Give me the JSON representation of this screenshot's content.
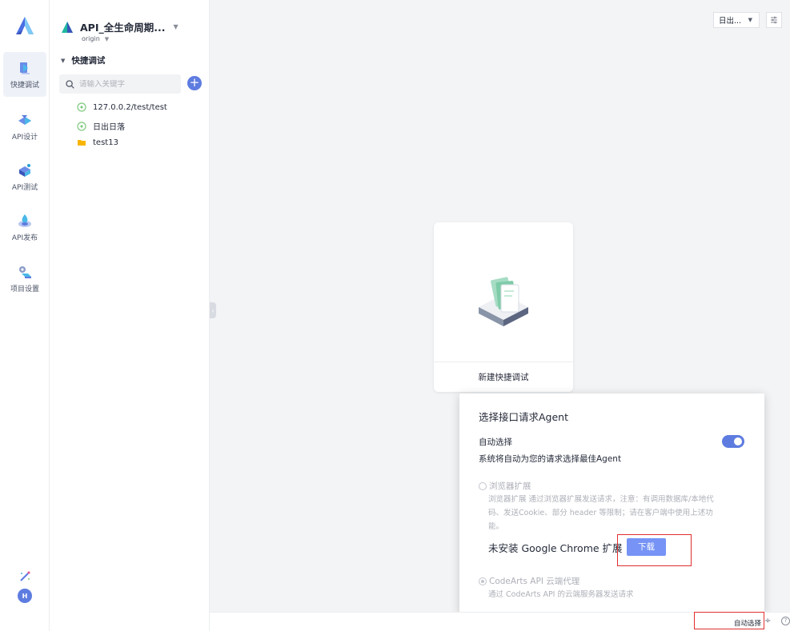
{
  "rail": {
    "items": [
      {
        "label": "快捷调试",
        "active": true
      },
      {
        "label": "API设计",
        "active": false
      },
      {
        "label": "API测试",
        "active": false
      },
      {
        "label": "API发布",
        "active": false
      },
      {
        "label": "项目设置",
        "active": false
      }
    ],
    "avatar_initial": "H"
  },
  "project": {
    "name": "API_全生命周期...",
    "branch": "origin"
  },
  "tree": {
    "section_title": "快捷调试",
    "search_placeholder": "请输入关键字",
    "add_label": "+",
    "items": [
      {
        "label": "127.0.0.2/test/test",
        "type": "request"
      },
      {
        "label": "日出日落",
        "type": "request"
      },
      {
        "label": "test13",
        "type": "folder"
      }
    ]
  },
  "main": {
    "env_select": "日出...",
    "new_card_label": "新建快捷调试"
  },
  "agent_popover": {
    "title": "选择接口请求Agent",
    "auto_label": "自动选择",
    "auto_desc": "系统将自动为您的请求选择最佳Agent",
    "auto_enabled": true,
    "browser_option": "浏览器扩展",
    "browser_desc": "浏览器扩展 通过浏览器扩展发送请求，注意：有调用数据库/本地代码、发送Cookie、部分 header 等限制；请在客户端中使用上述功能。",
    "not_installed": "未安装 Google Chrome 扩展",
    "download_label": "下载",
    "cloud_option": "CodeArts API 云端代理",
    "cloud_desc": "通过 CodeArts API 的云端服务器发送请求"
  },
  "statusbar": {
    "auto_select": "自动选择",
    "caret": "÷",
    "help": "?"
  },
  "colors": {
    "primary": "#5e7ce0",
    "download": "#7693f5",
    "highlight": "#e02e2e",
    "folder": "#f7b500",
    "request": "#7fc97f"
  }
}
